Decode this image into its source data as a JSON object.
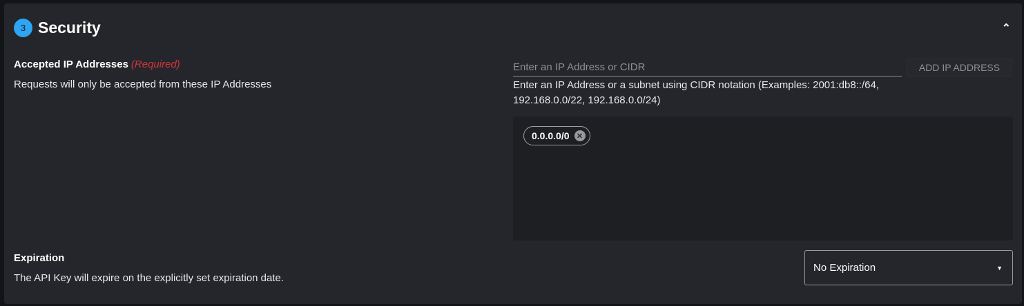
{
  "section": {
    "number": "3",
    "title": "Security",
    "collapse_icon": "chevron-up-icon"
  },
  "ip": {
    "label": "Accepted IP Addresses",
    "required": "(Required)",
    "description": "Requests will only be accepted from these IP Addresses",
    "placeholder": "Enter an IP Address or CIDR",
    "value": "",
    "add_button": "ADD IP ADDRESS",
    "hint": "Enter an IP Address or a subnet using CIDR notation (Examples: 2001:db8::/64, 192.168.0.0/22, 192.168.0.0/24)",
    "chips": [
      "0.0.0.0/0"
    ]
  },
  "expiration": {
    "label": "Expiration",
    "description": "The API Key will expire on the explicitly set expiration date.",
    "selected": "No Expiration"
  }
}
